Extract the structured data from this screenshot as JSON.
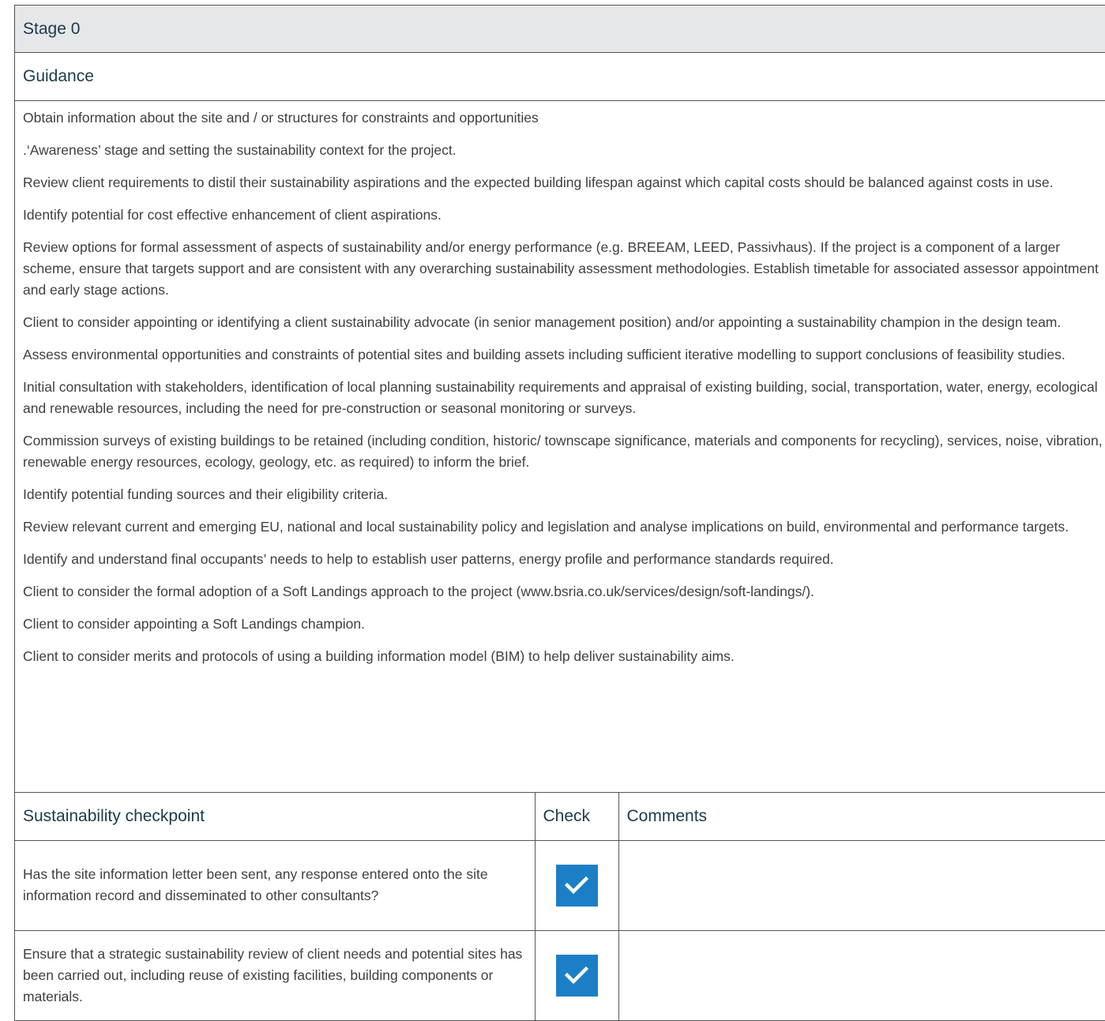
{
  "stage": {
    "title": "Stage 0"
  },
  "guidance": {
    "title": "Guidance",
    "items": [
      "Obtain information about the site and / or structures for constraints and opportunities",
      ".‘Awareness’ stage and setting the sustainability context for the project.",
      "Review client requirements to distil their sustainability aspirations and the expected building lifespan against which capital costs should be balanced against costs in use.",
      "Identify potential for cost effective enhancement of client aspirations.",
      "Review options for formal assessment of aspects of sustainability and/or energy performance (e.g. BREEAM, LEED, Passivhaus). If the project is a component of a larger scheme, ensure that targets support and are consistent with any overarching sustainability assessment methodologies. Establish timetable for associated assessor appointment and early stage actions.",
      "Client to consider appointing or identifying a client sustainability advocate (in senior management position) and/or appointing a sustainability champion in the design team.",
      "Assess environmental opportunities and constraints of potential sites and building assets including sufficient iterative modelling to support conclusions of feasibility studies.",
      "Initial consultation with stakeholders, identification of local planning sustainability requirements and appraisal of existing building, social, transportation, water, energy, ecological and renewable resources, including the need for pre-construction or seasonal monitoring or surveys.",
      "Commission surveys of existing buildings to be retained (including condition, historic/ townscape significance, materials and components for recycling), services, noise, vibration, renewable energy resources, ecology, geology, etc. as required) to inform the brief.",
      "Identify potential funding sources and their eligibility criteria.",
      "Review relevant current and emerging EU, national and local sustainability policy and legislation and analyse implications on build, environmental and performance targets.",
      "Identify and understand final occupants’ needs to help to establish user patterns, energy profile and performance standards required.",
      "Client to consider the formal adoption of a Soft Landings approach to the project (www.bsria.co.uk/services/design/soft-landings/).",
      "Client to consider appointing a Soft Landings champion.",
      "Client to consider merits and protocols of using a building information model (BIM) to help deliver sustainability aims."
    ]
  },
  "checkpoints": {
    "headers": {
      "checkpoint": "Sustainability checkpoint",
      "check": "Check",
      "comments": "Comments"
    },
    "rows": [
      {
        "text": "Has the site information letter been sent, any response entered onto the site information record and disseminated to other consultants?",
        "checked": true,
        "comments": ""
      },
      {
        "text": "Ensure that a strategic sustainability review of client needs and potential sites has been carried out, including reuse of existing facilities, building components or materials.",
        "checked": true,
        "comments": ""
      }
    ]
  },
  "colors": {
    "header_bg": "#e6e7e8",
    "heading_text": "#1b3a4b",
    "checkbox": "#1c7fc6"
  },
  "icons": {
    "checkbox": "checkbox-checked-icon"
  }
}
